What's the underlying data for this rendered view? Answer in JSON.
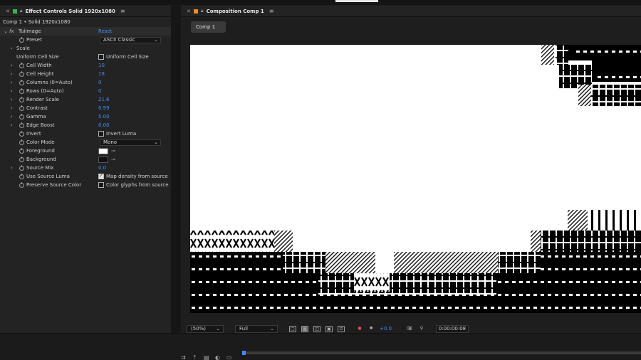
{
  "effect_panel": {
    "title": "Effect Controls Solid 1920x1080",
    "breadcrumb": "Comp 1 • Solid 1920x1080",
    "effect_name": "TuiImage",
    "reset_label": "Reset",
    "properties": [
      {
        "name": "Preset",
        "type": "dropdown",
        "value": "ASCII Classic"
      },
      {
        "name": "Scale",
        "type": "group"
      },
      {
        "name": "Uniform Cell Size",
        "type": "checkbox",
        "checked": false,
        "label": "Uniform Cell Size"
      },
      {
        "name": "Cell Width",
        "type": "number",
        "value": "10"
      },
      {
        "name": "Cell Height",
        "type": "number",
        "value": "18"
      },
      {
        "name": "Columns (0=Auto)",
        "type": "number",
        "value": "0"
      },
      {
        "name": "Rows (0=Auto)",
        "type": "number",
        "value": "0"
      },
      {
        "name": "Render Scale",
        "type": "number",
        "value": "21.6"
      },
      {
        "name": "Contrast",
        "type": "number",
        "value": "0.99"
      },
      {
        "name": "Gamma",
        "type": "number",
        "value": "5.00"
      },
      {
        "name": "Edge Boost",
        "type": "number",
        "value": "0.00"
      },
      {
        "name": "Invert",
        "type": "checkbox",
        "checked": false,
        "label": "Invert Luma"
      },
      {
        "name": "Color Mode",
        "type": "dropdown",
        "value": "Mono"
      },
      {
        "name": "Foreground",
        "type": "color",
        "value": "#ffffff"
      },
      {
        "name": "Background",
        "type": "color",
        "value": "#111111"
      },
      {
        "name": "Source Mix",
        "type": "number",
        "value": "0.0"
      },
      {
        "name": "Use Source Luma",
        "type": "checkbox",
        "checked": true,
        "label": "Map density from source"
      },
      {
        "name": "Preserve Source Color",
        "type": "checkbox",
        "checked": false,
        "label": "Color glyphs from source"
      }
    ]
  },
  "comp_panel": {
    "title": "Composition Comp 1",
    "tab_label": "Comp 1",
    "zoom": "(50%)",
    "resolution": "Full",
    "exposure": "+0.0",
    "timecode": "0:00:00:08"
  },
  "colors": {
    "accent": "#3f8cff",
    "effect_panel_icon": "#38b44a",
    "comp_panel_icon": "#f08a24"
  },
  "icons": [
    "close-icon",
    "lock-icon",
    "menu-icon",
    "fx-icon",
    "stopwatch-icon",
    "eyedropper-icon",
    "camera-icon",
    "region-icon",
    "grid-icon"
  ]
}
